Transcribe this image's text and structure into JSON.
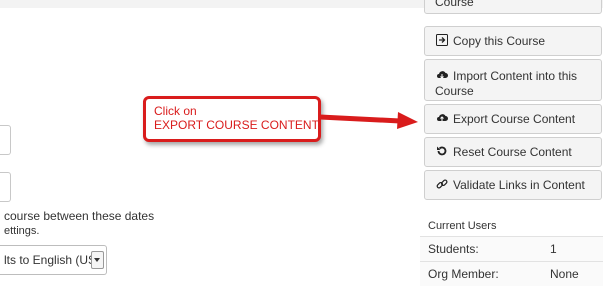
{
  "left": {
    "date_hint": "course between these dates",
    "settings_hint": "ettings.",
    "language_select_value": "lts to English (US)"
  },
  "sidebar": {
    "buttons": [
      {
        "label": "Course",
        "icon": "course-icon"
      },
      {
        "label": "Copy this Course",
        "icon": "copy-icon"
      },
      {
        "label": "Import Content into this Course",
        "icon": "cloud-download-icon"
      },
      {
        "label": "Export Course Content",
        "icon": "cloud-upload-icon"
      },
      {
        "label": "Reset Course Content",
        "icon": "reset-icon"
      },
      {
        "label": "Validate Links in Content",
        "icon": "link-icon"
      }
    ],
    "panel": {
      "title": "Current Users",
      "rows": [
        {
          "label": "Students:",
          "value": "1"
        },
        {
          "label": "Org Member:",
          "value": "None"
        }
      ]
    }
  },
  "callout": {
    "line1": "Click on",
    "line2": "EXPORT COURSE CONTENT",
    "color": "#d91c1c"
  }
}
